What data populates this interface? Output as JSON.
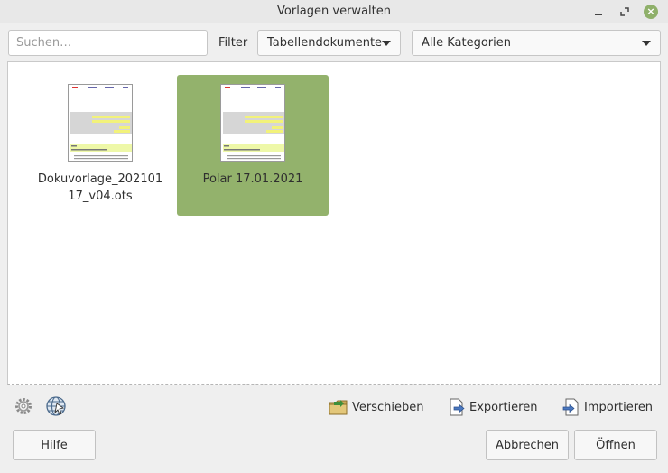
{
  "window": {
    "title": "Vorlagen verwalten",
    "close_glyph": "×"
  },
  "toolbar": {
    "search_placeholder": "Suchen…",
    "filter_label": "Filter",
    "doc_type": "Tabellendokumente",
    "category": "Alle Kategorien"
  },
  "templates": [
    {
      "name": "Dokuvorlage_20210117_v04.ots",
      "line1": "Dokuvorlage_202101",
      "line2": "17_v04.ots",
      "selected": false
    },
    {
      "name": "Polar 17.01.2021",
      "line1": "Polar 17.01.2021",
      "line2": "",
      "selected": true
    }
  ],
  "actions": {
    "move": "Verschieben",
    "export": "Exportieren",
    "import": "Importieren"
  },
  "buttons": {
    "help": "Hilfe",
    "cancel": "Abbrechen",
    "open": "Öffnen"
  },
  "colors": {
    "selection": "#93b26c",
    "close_button": "#8fb06a"
  },
  "icons": {
    "settings": "gear-icon",
    "online": "globe-icon",
    "move": "folder-move-icon",
    "export": "export-icon",
    "import": "import-icon"
  }
}
